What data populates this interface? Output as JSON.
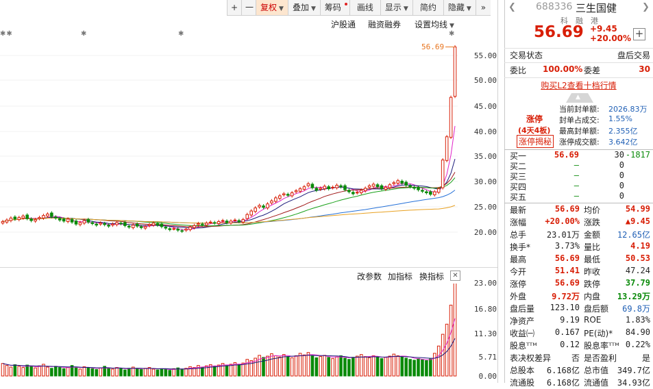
{
  "toolbar": {
    "plus": "+",
    "minus": "一",
    "fuquan": "复权",
    "diejia": "叠加",
    "chouma": "筹码",
    "huaxian": "画线",
    "xianshi": "显示",
    "jianyue": "简约",
    "yincang": "隐藏",
    "collapse": "»"
  },
  "chart_options": {
    "hgt": "沪股通",
    "rzrq": "融资融券",
    "set_ma": "设置均线"
  },
  "price_axis": [
    "55.00",
    "50.00",
    "45.00",
    "40.00",
    "35.00",
    "30.00",
    "25.00",
    "20.00"
  ],
  "last_price_marker": "56.69",
  "volume_options": {
    "params": "改参数",
    "add": "加指标",
    "change": "换指标"
  },
  "volume_axis": [
    "23.00",
    "16.80",
    "11.30",
    "5.71",
    "0.00"
  ],
  "chart_data": {
    "type": "candlestick",
    "title": "",
    "y_ticks": [
      55.0,
      50.0,
      45.0,
      40.0,
      35.0,
      30.0,
      25.0,
      20.0
    ],
    "last_price": 56.69,
    "volume_ticks": [
      23.0,
      16.8,
      11.3,
      5.71,
      0.0
    ],
    "closes": [
      22.1,
      22.4,
      22.8,
      22.6,
      22.9,
      23.2,
      22.7,
      22.3,
      22.5,
      22.9,
      23.3,
      23.6,
      23.1,
      22.8,
      22.4,
      22.2,
      22.6,
      22.0,
      21.6,
      21.9,
      22.3,
      22.0,
      21.7,
      21.4,
      21.8,
      21.5,
      21.2,
      21.6,
      21.9,
      21.7,
      21.3,
      21.0,
      21.4,
      21.2,
      20.9,
      21.1,
      21.5,
      21.8,
      21.4,
      21.1,
      20.8,
      20.5,
      20.7,
      20.4,
      20.2,
      20.6,
      21.0,
      21.3,
      21.7,
      21.5,
      21.8,
      22.0,
      21.8,
      22.1,
      22.3,
      21.9,
      22.2,
      22.4,
      22.1,
      22.5,
      23.5,
      24.2,
      24.8,
      25.3,
      24.9,
      25.6,
      26.2,
      26.8,
      27.2,
      27.6,
      27.3,
      27.8,
      28.2,
      28.6,
      29.0,
      29.6,
      28.8,
      28.3,
      28.7,
      29.1,
      28.6,
      28.9,
      29.3,
      29.0,
      28.4,
      28.0,
      27.6,
      27.9,
      28.3,
      28.7,
      29.2,
      29.5,
      29.0,
      28.6,
      28.9,
      29.4,
      29.8,
      30.2,
      29.7,
      29.3,
      29.0,
      28.7,
      28.4,
      28.1,
      27.8,
      27.5,
      28.0,
      28.6,
      34.3,
      38.9,
      46.7,
      56.69
    ],
    "volume": [
      3.1,
      2.6,
      2.2,
      2.8,
      2.4,
      2.1,
      2.7,
      2.3,
      2.0,
      2.5,
      2.9,
      2.2,
      1.9,
      2.4,
      2.1,
      1.8,
      2.2,
      2.6,
      2.0,
      1.7,
      2.3,
      2.1,
      1.8,
      1.6,
      2.0,
      2.4,
      1.9,
      1.7,
      2.1,
      1.8,
      1.5,
      1.9,
      2.2,
      1.8,
      1.6,
      1.9,
      2.1,
      1.7,
      1.5,
      1.8,
      1.6,
      1.4,
      1.8,
      2.0,
      1.7,
      1.9,
      2.3,
      2.1,
      2.6,
      2.2,
      2.5,
      2.8,
      2.4,
      2.7,
      3.1,
      2.6,
      2.9,
      3.3,
      2.8,
      3.2,
      4.1,
      3.8,
      4.4,
      5.1,
      4.6,
      4.9,
      5.5,
      5.0,
      4.7,
      5.3,
      4.8,
      4.5,
      5.0,
      5.6,
      5.2,
      5.8,
      4.9,
      4.5,
      4.8,
      5.1,
      4.6,
      4.3,
      4.7,
      5.0,
      4.4,
      4.1,
      4.6,
      4.9,
      5.3,
      4.8,
      4.5,
      5.0,
      4.7,
      4.3,
      4.6,
      4.9,
      5.4,
      5.0,
      4.7,
      4.4,
      4.1,
      3.9,
      4.3,
      4.0,
      3.8,
      4.2,
      5.6,
      7.4,
      10.3,
      12.8,
      17.5,
      23.0
    ]
  },
  "stock": {
    "code": "688336",
    "name": "三生国健",
    "tags": [
      "科",
      "融",
      "港"
    ],
    "price": "56.69",
    "change": "+9.45",
    "change_pct": "+20.00%",
    "add_btn": "+"
  },
  "status": {
    "label": "交易状态",
    "value": "盘后交易"
  },
  "weibi": {
    "lbl1": "委比",
    "val1": "100.00%",
    "lbl2": "委差",
    "val2": "30"
  },
  "l2_link": "购买L2查看十档行情",
  "limit": {
    "tag": "涨停",
    "days": "(4天4板)",
    "reveal": "涨停揭秘",
    "rows": [
      {
        "label": "当前封单额:",
        "value": "2026.83万"
      },
      {
        "label": "封单占成交:",
        "value": "1.55%"
      },
      {
        "label": "最高封单额:",
        "value": "2.355亿"
      },
      {
        "label": "涨停成交额:",
        "value": "3.642亿"
      }
    ]
  },
  "orderbook": [
    {
      "label": "买一",
      "price": "56.69",
      "vol": "30",
      "chg": "-1817"
    },
    {
      "label": "买二",
      "price": "—",
      "vol": "0",
      "chg": ""
    },
    {
      "label": "买三",
      "price": "—",
      "vol": "0",
      "chg": ""
    },
    {
      "label": "买四",
      "price": "—",
      "vol": "0",
      "chg": ""
    },
    {
      "label": "买五",
      "price": "—",
      "vol": "0",
      "chg": ""
    }
  ],
  "quote": [
    {
      "l1": "最新",
      "v1": "56.69",
      "c1": "red",
      "l2": "均价",
      "v2": "54.99",
      "c2": "red"
    },
    {
      "l1": "涨幅",
      "v1": "+20.00%",
      "c1": "red",
      "l2": "涨跌",
      "v2": "▲9.45",
      "c2": "red"
    },
    {
      "l1": "总手",
      "v1": "23.01万",
      "c1": "dark",
      "l2": "金额",
      "v2": "12.65亿",
      "c2": "blue"
    },
    {
      "l1": "换手*",
      "v1": "3.73%",
      "c1": "dark",
      "l2": "量比",
      "v2": "4.19",
      "c2": "red"
    },
    {
      "l1": "最高",
      "v1": "56.69",
      "c1": "red",
      "l2": "最低",
      "v2": "50.53",
      "c2": "red"
    },
    {
      "l1": "今开",
      "v1": "51.41",
      "c1": "red",
      "l2": "昨收",
      "v2": "47.24",
      "c2": "dark"
    },
    {
      "l1": "涨停",
      "v1": "56.69",
      "c1": "red",
      "l2": "跌停",
      "v2": "37.79",
      "c2": "green"
    },
    {
      "l1": "外盘",
      "v1": "9.72万",
      "c1": "red",
      "l2": "内盘",
      "v2": "13.29万",
      "c2": "green"
    },
    {
      "l1": "盘后量",
      "v1": "123.10",
      "c1": "dark",
      "l2": "盘后额",
      "v2": "69.8万",
      "c2": "blue"
    },
    {
      "l1": "净资产",
      "v1": "9.19",
      "c1": "dark",
      "l2": "ROE",
      "v2": "1.83%",
      "c2": "dark"
    },
    {
      "l1": "收益㈠",
      "v1": "0.167",
      "c1": "dark",
      "l2": "PE(动)*",
      "v2": "84.90",
      "c2": "dark"
    },
    {
      "l1": "股息ᵀᵀᴹ",
      "v1": "0.12",
      "c1": "dark",
      "l2": "股息率ᵀᵀᴹ",
      "v2": "0.22%",
      "c2": "dark"
    },
    {
      "l1": "表决权差异",
      "v1": "否",
      "c1": "dark",
      "l2": "是否盈利",
      "v2": "是",
      "c2": "dark"
    },
    {
      "l1": "总股本",
      "v1": "6.168亿",
      "c1": "dark",
      "l2": "总市值",
      "v2": "349.7亿",
      "c2": "dark"
    },
    {
      "l1": "流通股",
      "v1": "6.168亿",
      "c1": "dark",
      "l2": "流通值",
      "v2": "34.93亿",
      "c2": "dark"
    }
  ],
  "colors": {
    "up": "#d81e06",
    "down": "#0a8a0a",
    "accent": "#e8741e"
  }
}
